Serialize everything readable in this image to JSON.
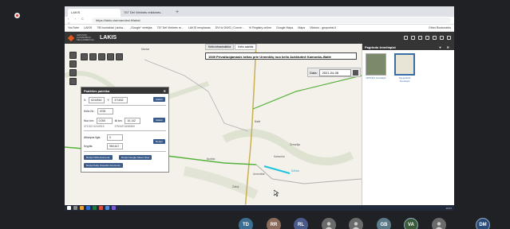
{
  "browser": {
    "tabs": [
      "LAKIS",
      "757 Dėl Vietinės reikšmės..."
    ],
    "new_tab": "+",
    "nav": "‹ › C ⌂",
    "url": "https://lakis.vlamrandesi.lt/lakis/",
    "bookmarks": [
      "YouTube",
      "LAKIS",
      "750 kontaktai | sinka...",
      "„Google“ vertėjas",
      "757 Dėl Vietinės re...",
      "LAKIS neoplanas",
      "DVI to DWG | Conve...",
      "VI Registry online",
      "Google Maps",
      "Maps",
      "Viktorio - geoportal.lt"
    ],
    "bookmarks_other": "Other Bookmarks"
  },
  "app": {
    "org_name": "LIETUVOS AUTOMOBILIŲ KELIŲ DIREKCIJA",
    "name": "LAKIS",
    "accent_color": "#e2571e",
    "header_color": "#353535"
  },
  "map": {
    "tabs": [
      "Kelio infrastruktūra",
      "Kelio aukštis"
    ],
    "route_title": "1949 Privažiuojamasis kelias prie Urmedžių nuo kelio Aukštutinė Kamonka–Baltė",
    "date_label": "Data:",
    "date_value": "2021-04-08",
    "labels": [
      "Mordar",
      "Noviliai",
      "Baltė",
      "Žemaitija",
      "Žalioji",
      "Urmedžiai",
      "Kamonka",
      "5.8 km"
    ],
    "coordinates": "LKS: 244 475.3 E, 6 245 165 N 3m"
  },
  "sidebar": {
    "title": "Pagrindo žemėlapiai",
    "basemaps": [
      "ORT10LT žemėlapis",
      "Topografinis žemėlapis"
    ]
  },
  "panel": {
    "title": "Padėties paieška",
    "x_label": "X:",
    "x_value": "6244916",
    "y_label": "Y:",
    "y_value": "371532",
    "search_button": "Ieškoti",
    "road_label": "Kelio Nr.:",
    "road_value": "3705",
    "from_label": "Nuo km:",
    "from_value": "0,000",
    "to_label": "Iki km:",
    "to_value": "10,142",
    "from_coords": "371322 6244916",
    "to_coords": "375349 6246560",
    "search_button2": "Ieškoti",
    "distance_label": "Atkarpos ilgis:",
    "distance_value": "0",
    "direction_label": "Kryptis:",
    "direction_value": "950,617",
    "show_button": "Rodyti",
    "buttons": [
      "Rodyti Orbit duomenis",
      "Rodyti Google Street View",
      "Rodyti Kelių Intaesitio duomenis"
    ]
  },
  "taskbar": {
    "clock": "10:27"
  },
  "participants": [
    {
      "initials": "TD",
      "color": "#3c6e91"
    },
    {
      "initials": "RR",
      "color": "#8a6a5a"
    },
    {
      "initials": "RL",
      "color": "#4a5a8a"
    },
    {
      "initials": "",
      "color": "#6a6a6a"
    },
    {
      "initials": "",
      "color": "#6a6a6a"
    },
    {
      "initials": "GB",
      "color": "#5a7a8a"
    },
    {
      "initials": "VA",
      "color": "#3a5a3a"
    },
    {
      "initials": "",
      "color": "#6a6a6a"
    },
    {
      "initials": "DM",
      "color": "#2a4a7a"
    }
  ]
}
